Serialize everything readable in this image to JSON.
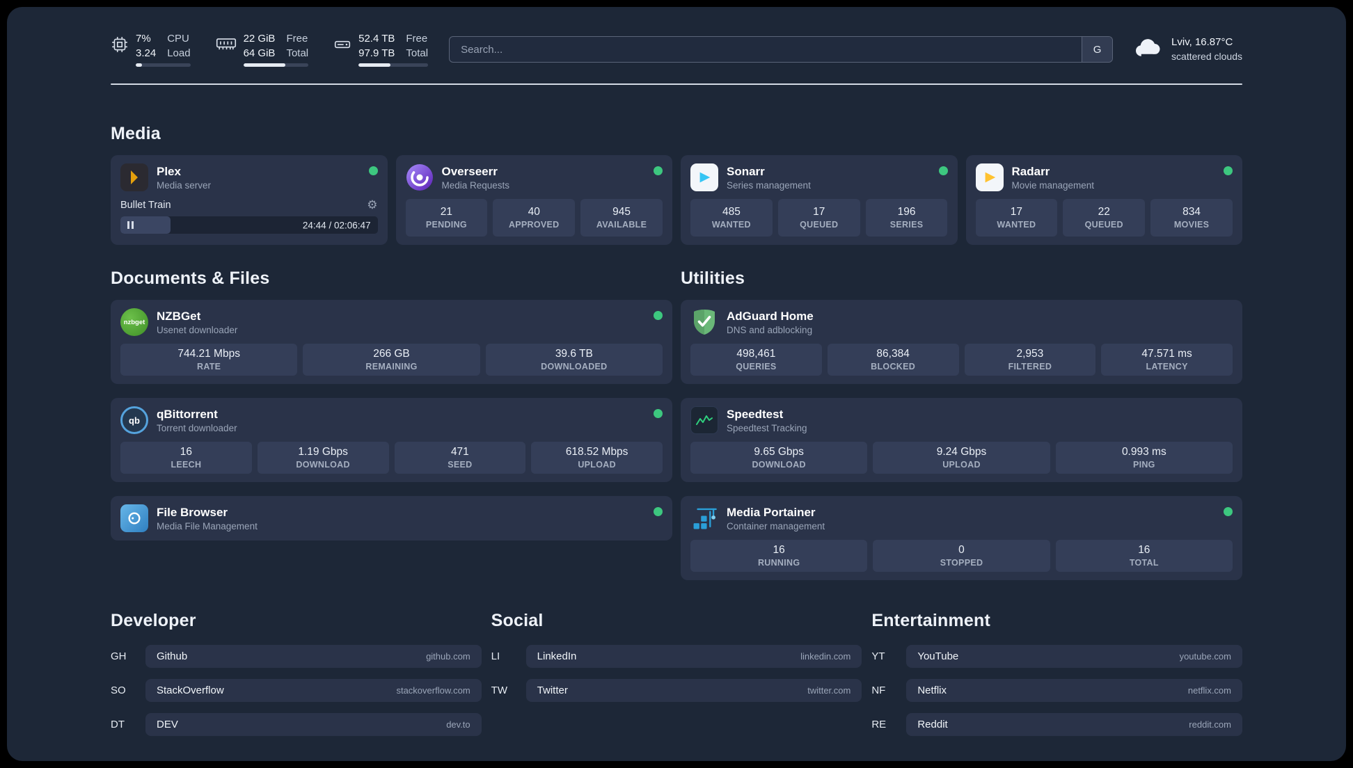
{
  "colors": {
    "bg": "#1d2737",
    "card": "#2a3349",
    "tile": "#343e58",
    "green": "#3dc77f",
    "muted": "#9aa5b8"
  },
  "topbar": {
    "cpu": {
      "value1": "7%",
      "label1": "CPU",
      "value2": "3.24",
      "label2": "Load",
      "bar_percent": 12
    },
    "ram": {
      "value1": "22 GiB",
      "label1": "Free",
      "value2": "64 GiB",
      "label2": "Total",
      "bar_percent": 65
    },
    "disk": {
      "value1": "52.4 TB",
      "label1": "Free",
      "value2": "97.9 TB",
      "label2": "Total",
      "bar_percent": 46
    },
    "search": {
      "placeholder": "Search...",
      "engine": "G"
    },
    "weather": {
      "title": "Lviv, 16.87°C",
      "subtitle": "scattered clouds"
    }
  },
  "media": {
    "title": "Media",
    "plex": {
      "name": "Plex",
      "desc": "Media server",
      "now_playing": "Bullet Train",
      "time": "24:44 / 02:06:47",
      "progress_percent": 19.5
    },
    "overseerr": {
      "name": "Overseerr",
      "desc": "Media Requests",
      "stats": [
        {
          "value": "21",
          "label": "PENDING"
        },
        {
          "value": "40",
          "label": "APPROVED"
        },
        {
          "value": "945",
          "label": "AVAILABLE"
        }
      ]
    },
    "sonarr": {
      "name": "Sonarr",
      "desc": "Series management",
      "stats": [
        {
          "value": "485",
          "label": "WANTED"
        },
        {
          "value": "17",
          "label": "QUEUED"
        },
        {
          "value": "196",
          "label": "SERIES"
        }
      ]
    },
    "radarr": {
      "name": "Radarr",
      "desc": "Movie management",
      "stats": [
        {
          "value": "17",
          "label": "WANTED"
        },
        {
          "value": "22",
          "label": "QUEUED"
        },
        {
          "value": "834",
          "label": "MOVIES"
        }
      ]
    }
  },
  "documents": {
    "title": "Documents & Files",
    "nzbget": {
      "name": "NZBGet",
      "desc": "Usenet downloader",
      "icon_text": "nzbget",
      "stats": [
        {
          "value": "744.21 Mbps",
          "label": "RATE"
        },
        {
          "value": "266 GB",
          "label": "REMAINING"
        },
        {
          "value": "39.6 TB",
          "label": "DOWNLOADED"
        }
      ]
    },
    "qbittorrent": {
      "name": "qBittorrent",
      "desc": "Torrent downloader",
      "icon_text": "qb",
      "stats": [
        {
          "value": "16",
          "label": "LEECH"
        },
        {
          "value": "1.19 Gbps",
          "label": "DOWNLOAD"
        },
        {
          "value": "471",
          "label": "SEED"
        },
        {
          "value": "618.52 Mbps",
          "label": "UPLOAD"
        }
      ]
    },
    "filebrowser": {
      "name": "File Browser",
      "desc": "Media File Management"
    }
  },
  "utilities": {
    "title": "Utilities",
    "adguard": {
      "name": "AdGuard Home",
      "desc": "DNS and adblocking",
      "stats": [
        {
          "value": "498,461",
          "label": "QUERIES"
        },
        {
          "value": "86,384",
          "label": "BLOCKED"
        },
        {
          "value": "2,953",
          "label": "FILTERED"
        },
        {
          "value": "47.571 ms",
          "label": "LATENCY"
        }
      ]
    },
    "speedtest": {
      "name": "Speedtest",
      "desc": "Speedtest Tracking",
      "stats": [
        {
          "value": "9.65 Gbps",
          "label": "DOWNLOAD"
        },
        {
          "value": "9.24 Gbps",
          "label": "UPLOAD"
        },
        {
          "value": "0.993 ms",
          "label": "PING"
        }
      ]
    },
    "portainer": {
      "name": "Media Portainer",
      "desc": "Container management",
      "stats": [
        {
          "value": "16",
          "label": "RUNNING"
        },
        {
          "value": "0",
          "label": "STOPPED"
        },
        {
          "value": "16",
          "label": "TOTAL"
        }
      ]
    }
  },
  "bookmarks": {
    "developer": {
      "title": "Developer",
      "items": [
        {
          "abbr": "GH",
          "name": "Github",
          "url": "github.com"
        },
        {
          "abbr": "SO",
          "name": "StackOverflow",
          "url": "stackoverflow.com"
        },
        {
          "abbr": "DT",
          "name": "DEV",
          "url": "dev.to"
        }
      ]
    },
    "social": {
      "title": "Social",
      "items": [
        {
          "abbr": "LI",
          "name": "LinkedIn",
          "url": "linkedin.com"
        },
        {
          "abbr": "TW",
          "name": "Twitter",
          "url": "twitter.com"
        }
      ]
    },
    "entertainment": {
      "title": "Entertainment",
      "items": [
        {
          "abbr": "YT",
          "name": "YouTube",
          "url": "youtube.com"
        },
        {
          "abbr": "NF",
          "name": "Netflix",
          "url": "netflix.com"
        },
        {
          "abbr": "RE",
          "name": "Reddit",
          "url": "reddit.com"
        }
      ]
    }
  }
}
